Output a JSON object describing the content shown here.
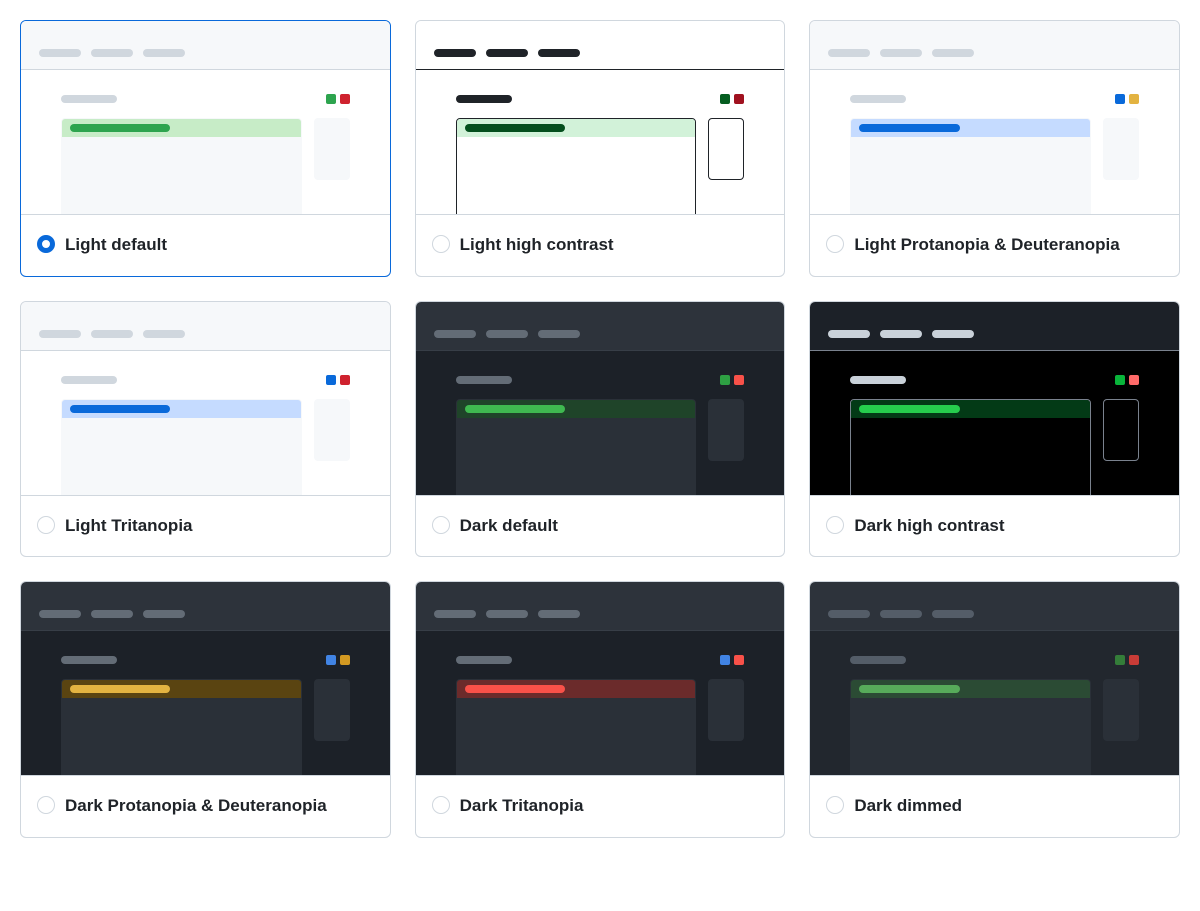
{
  "themes": [
    {
      "id": "light-default",
      "label": "Light default",
      "selected": true,
      "colors": {
        "tabs_bg": "#f6f8fa",
        "tab": "#d0d7de",
        "body_bg": "#ffffff",
        "divider": "#d0d7de",
        "pill": "#d0d7de",
        "dot1": "#2da44e",
        "dot2": "#cf222e",
        "block_bg": "#f6f8fa",
        "block_border": "transparent",
        "hl_bg": "#c7ecc7",
        "hl_bar": "#2da44e",
        "side_bg": "#f6f8fa",
        "side_border": "transparent",
        "outline": false
      }
    },
    {
      "id": "light-high-contrast",
      "label": "Light high contrast",
      "selected": false,
      "colors": {
        "tabs_bg": "#ffffff",
        "tab": "#1f2328",
        "body_bg": "#ffffff",
        "divider": "#1f2328",
        "pill": "#1f2328",
        "dot1": "#055d20",
        "dot2": "#a0111f",
        "block_bg": "#ffffff",
        "block_border": "#1f2328",
        "hl_bg": "#d2f2d9",
        "hl_bar": "#044f1d",
        "side_bg": "#ffffff",
        "side_border": "#1f2328",
        "outline": true
      }
    },
    {
      "id": "light-protanopia-deuteranopia",
      "label": "Light Protanopia & Deuteranopia",
      "selected": false,
      "colors": {
        "tabs_bg": "#f6f8fa",
        "tab": "#d0d7de",
        "body_bg": "#ffffff",
        "divider": "#d0d7de",
        "pill": "#d0d7de",
        "dot1": "#0969da",
        "dot2": "#e3b341",
        "block_bg": "#f6f8fa",
        "block_border": "transparent",
        "hl_bg": "#c5dbff",
        "hl_bar": "#0969da",
        "side_bg": "#f6f8fa",
        "side_border": "transparent",
        "outline": false
      }
    },
    {
      "id": "light-tritanopia",
      "label": "Light Tritanopia",
      "selected": false,
      "colors": {
        "tabs_bg": "#f6f8fa",
        "tab": "#d0d7de",
        "body_bg": "#ffffff",
        "divider": "#d0d7de",
        "pill": "#d0d7de",
        "dot1": "#0969da",
        "dot2": "#cf222e",
        "block_bg": "#f6f8fa",
        "block_border": "transparent",
        "hl_bg": "#c5dbff",
        "hl_bar": "#0969da",
        "side_bg": "#f6f8fa",
        "side_border": "transparent",
        "outline": false
      }
    },
    {
      "id": "dark-default",
      "label": "Dark default",
      "selected": false,
      "colors": {
        "tabs_bg": "#2d333b",
        "tab": "#636c76",
        "body_bg": "#1c2128",
        "divider": "#373e47",
        "pill": "#636c76",
        "dot1": "#2ea043",
        "dot2": "#f85149",
        "block_bg": "#2a3038",
        "block_border": "transparent",
        "hl_bg": "#1f4429",
        "hl_bar": "#3fb950",
        "side_bg": "#2a3038",
        "side_border": "transparent",
        "outline": false
      }
    },
    {
      "id": "dark-high-contrast",
      "label": "Dark high contrast",
      "selected": false,
      "colors": {
        "tabs_bg": "#1c2128",
        "tab": "#c9d1d9",
        "body_bg": "#000000",
        "divider": "#7a828e",
        "pill": "#c9d1d9",
        "dot1": "#09b43a",
        "dot2": "#ff6a69",
        "block_bg": "#000000",
        "block_border": "#7a828e",
        "hl_bg": "#033a16",
        "hl_bar": "#26cd4d",
        "side_bg": "#000000",
        "side_border": "#7a828e",
        "outline": true
      }
    },
    {
      "id": "dark-protanopia-deuteranopia",
      "label": "Dark Protanopia & Deuteranopia",
      "selected": false,
      "colors": {
        "tabs_bg": "#2d333b",
        "tab": "#636c76",
        "body_bg": "#1c2128",
        "divider": "#373e47",
        "pill": "#636c76",
        "dot1": "#4184e4",
        "dot2": "#d29922",
        "block_bg": "#2a3038",
        "block_border": "transparent",
        "hl_bg": "#5a4411",
        "hl_bar": "#e3b341",
        "side_bg": "#2a3038",
        "side_border": "transparent",
        "outline": false
      }
    },
    {
      "id": "dark-tritanopia",
      "label": "Dark Tritanopia",
      "selected": false,
      "colors": {
        "tabs_bg": "#2d333b",
        "tab": "#636c76",
        "body_bg": "#1c2128",
        "divider": "#373e47",
        "pill": "#636c76",
        "dot1": "#4184e4",
        "dot2": "#f85149",
        "block_bg": "#2a3038",
        "block_border": "transparent",
        "hl_bg": "#6b2b2b",
        "hl_bar": "#f85149",
        "side_bg": "#2a3038",
        "side_border": "transparent",
        "outline": false
      }
    },
    {
      "id": "dark-dimmed",
      "label": "Dark dimmed",
      "selected": false,
      "colors": {
        "tabs_bg": "#2d333b",
        "tab": "#545d68",
        "body_bg": "#22272e",
        "divider": "#373e47",
        "pill": "#545d68",
        "dot1": "#347d39",
        "dot2": "#c93c37",
        "block_bg": "#2a3038",
        "block_border": "transparent",
        "hl_bg": "#2b4b34",
        "hl_bar": "#57ab5a",
        "side_bg": "#2a3038",
        "side_border": "transparent",
        "outline": false
      }
    }
  ]
}
